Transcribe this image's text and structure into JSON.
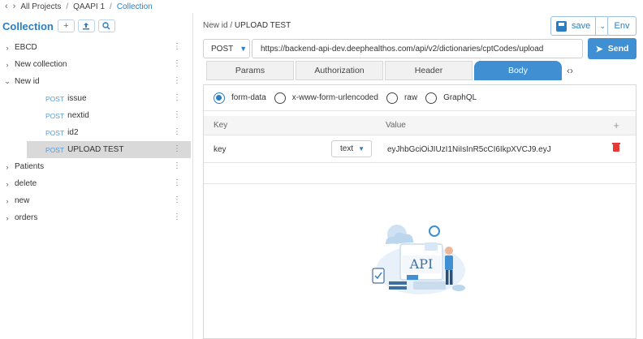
{
  "topnav": {
    "crumbs": [
      "All Projects",
      "QAAPI 1",
      "Collection"
    ]
  },
  "sidebar": {
    "title": "Collection",
    "items": [
      {
        "label": "EBCD"
      },
      {
        "label": "New collection"
      },
      {
        "label": "New id"
      },
      {
        "label": "Patients"
      },
      {
        "label": "delete"
      },
      {
        "label": "new"
      },
      {
        "label": "orders"
      }
    ],
    "children": [
      {
        "method": "POST",
        "label": "issue"
      },
      {
        "method": "POST",
        "label": "nextid"
      },
      {
        "method": "POST",
        "label": "id2"
      },
      {
        "method": "POST",
        "label": "UPLOAD TEST"
      }
    ]
  },
  "request": {
    "crumb_parent": "New id",
    "crumb_current": "UPLOAD TEST",
    "save_label": "save",
    "env_label": "Env",
    "method": "POST",
    "url": "https://backend-api-dev.deephealthos.com/api/v2/dictionaries/cptCodes/upload",
    "send_label": "Send"
  },
  "tabs": [
    "Params",
    "Authorization",
    "Header",
    "Body"
  ],
  "body": {
    "options": [
      "form-data",
      "x-www-form-urlencoded",
      "raw",
      "GraphQL"
    ],
    "selected": "form-data",
    "headers": {
      "key": "Key",
      "value": "Value"
    },
    "rows": [
      {
        "key": "key",
        "type": "text",
        "value": "eyJhbGciOiJIUzI1NiIsInR5cCI6IkpXVCJ9.eyJ"
      }
    ],
    "illustration_label": "API"
  },
  "colors": {
    "accent": "#2c7ec2",
    "send": "#3f8fd2",
    "delete": "#e53935"
  }
}
